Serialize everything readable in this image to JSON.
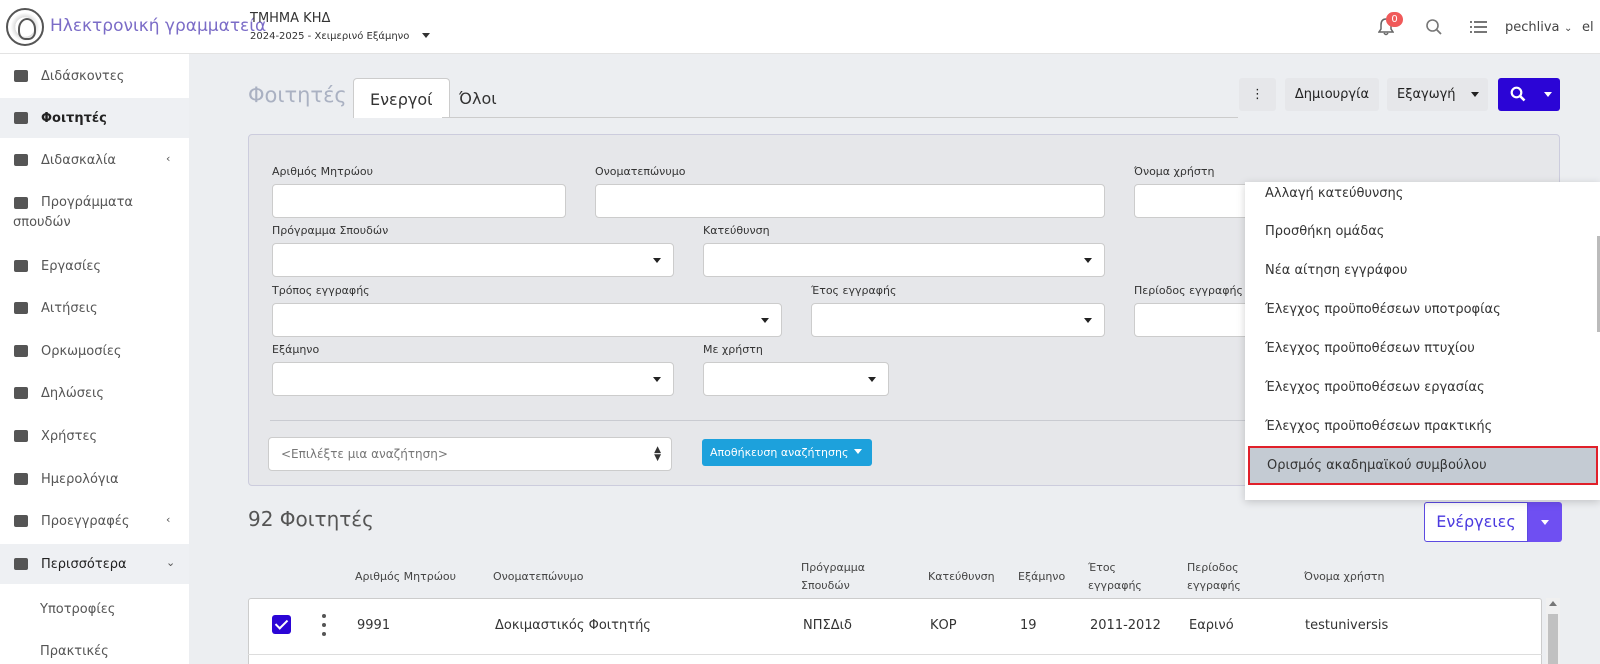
{
  "header": {
    "brand": "Ηλεκτρονική γραμματεία",
    "department": "ΤΜΗΜΑ ΚΗΔ",
    "term": "2024-2025 - Χειμερινό Εξάμηνο",
    "notifications_count": "0",
    "username": "pechliva",
    "language": "el"
  },
  "sidebar": {
    "items": [
      {
        "label": "Διδάσκοντες"
      },
      {
        "label": "Φοιτητές"
      },
      {
        "label": "Διδασκαλία"
      },
      {
        "label": "Προγράμματα",
        "label2": "σπουδών"
      },
      {
        "label": "Εργασίες"
      },
      {
        "label": "Αιτήσεις"
      },
      {
        "label": "Ορκωμοσίες"
      },
      {
        "label": "Δηλώσεις"
      },
      {
        "label": "Χρήστες"
      },
      {
        "label": "Ημερολόγια"
      },
      {
        "label": "Προεγγραφές"
      },
      {
        "label": "Περισσότερα"
      }
    ],
    "subitems": [
      "Υποτροφίες",
      "Πρακτικές"
    ]
  },
  "main": {
    "title": "Φοιτητές",
    "tabs": [
      "Ενεργοί",
      "Όλοι"
    ],
    "toolbar": {
      "more": "⋮",
      "create": "Δημιουργία",
      "export": "Εξαγωγή"
    }
  },
  "filters": {
    "labels": {
      "student_id": "Αριθμός Μητρώου",
      "full_name": "Ονοματεπώνυμο",
      "username": "Όνομα χρήστη",
      "program": "Πρόγραμμα Σπουδών",
      "direction": "Κατεύθυνση",
      "enroll_mode": "Τρόπος εγγραφής",
      "enroll_year": "Έτος εγγραφής",
      "enroll_period": "Περίοδος εγγραφής",
      "semester": "Εξάμηνο",
      "with_user": "Με χρήστη"
    },
    "saved_placeholder": "<Επιλέξτε μια αναζήτηση>",
    "save_search": "Αποθήκευση αναζήτησης"
  },
  "menu": {
    "items": [
      "Αλλαγή κατεύθυνσης",
      "Προσθήκη ομάδας",
      "Νέα αίτηση εγγράφου",
      "Έλεγχος προϋποθέσεων υποτροφίας",
      "Έλεγχος προϋποθέσεων πτυχίου",
      "Έλεγχος προϋποθέσεων εργασίας",
      "Έλεγχος προϋποθέσεων πρακτικής",
      "Ορισμός ακαδημαϊκού συμβούλου"
    ]
  },
  "results": {
    "count_title": "92 Φοιτητές",
    "actions": "Ενέργειες"
  },
  "table": {
    "headers": {
      "student_id": "Αριθμός Μητρώου",
      "full_name": "Ονοματεπώνυμο",
      "program_1": "Πρόγραμμα",
      "program_2": "Σπουδών",
      "direction": "Κατεύθυνση",
      "semester": "Εξάμηνο",
      "year_1": "Έτος",
      "year_2": "εγγραφής",
      "period_1": "Περίοδος",
      "period_2": "εγγραφής",
      "username": "Όνομα χρήστη"
    },
    "rows": [
      {
        "student_id": "9991",
        "full_name": "Δοκιμαστικός Φοιτητής",
        "program": "ΝΠΣΔιδ",
        "direction": "ΚΟΡ",
        "semester": "19",
        "year": "2011-2012",
        "period": "Εαρινό",
        "username": "testuniversis"
      }
    ]
  },
  "colors": {
    "accent": "#2b05d6",
    "brand": "#7b6cc7",
    "save_button": "#1da1dc",
    "highlight_border": "#e0202a"
  }
}
